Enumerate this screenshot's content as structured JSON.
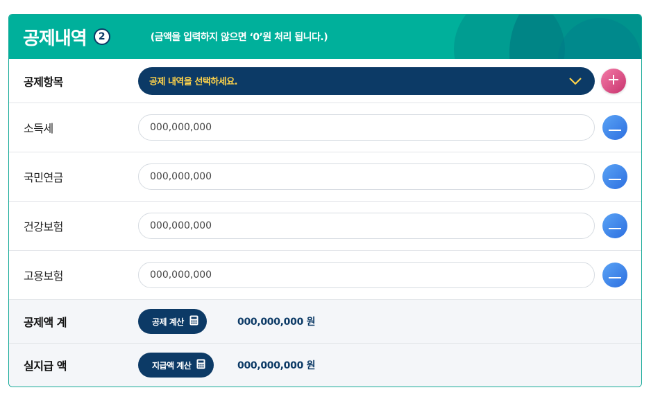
{
  "header": {
    "title": "공제내역",
    "step": "2",
    "note": "(금액을 입력하지 않으면 ‘0’원 처리 됩니다.)"
  },
  "select_row": {
    "label": "공제항목",
    "select_text": "공제 내역을 선택하세요.",
    "icons": {
      "dropdown": "chevron-down-icon",
      "add": "plus-icon"
    },
    "colors": {
      "select_bg": "#0c3a66",
      "select_text": "#ffd34a",
      "add_button": "#d94a82"
    }
  },
  "items": [
    {
      "label": "소득세",
      "placeholder": "000,000,000"
    },
    {
      "label": "국민연금",
      "placeholder": "000,000,000"
    },
    {
      "label": "건강보험",
      "placeholder": "000,000,000"
    },
    {
      "label": "고용보험",
      "placeholder": "000,000,000"
    }
  ],
  "summary": {
    "deduction_total": {
      "label": "공제액 계",
      "button": "공제 계산",
      "amount": "000,000,000 원"
    },
    "net_pay": {
      "label": "실지급 액",
      "button": "지급액 계산",
      "amount": "000,000,000 원"
    }
  },
  "colors": {
    "header_bg": "#00b09b",
    "navy": "#0c3a66",
    "remove_button": "#3b82f0"
  }
}
